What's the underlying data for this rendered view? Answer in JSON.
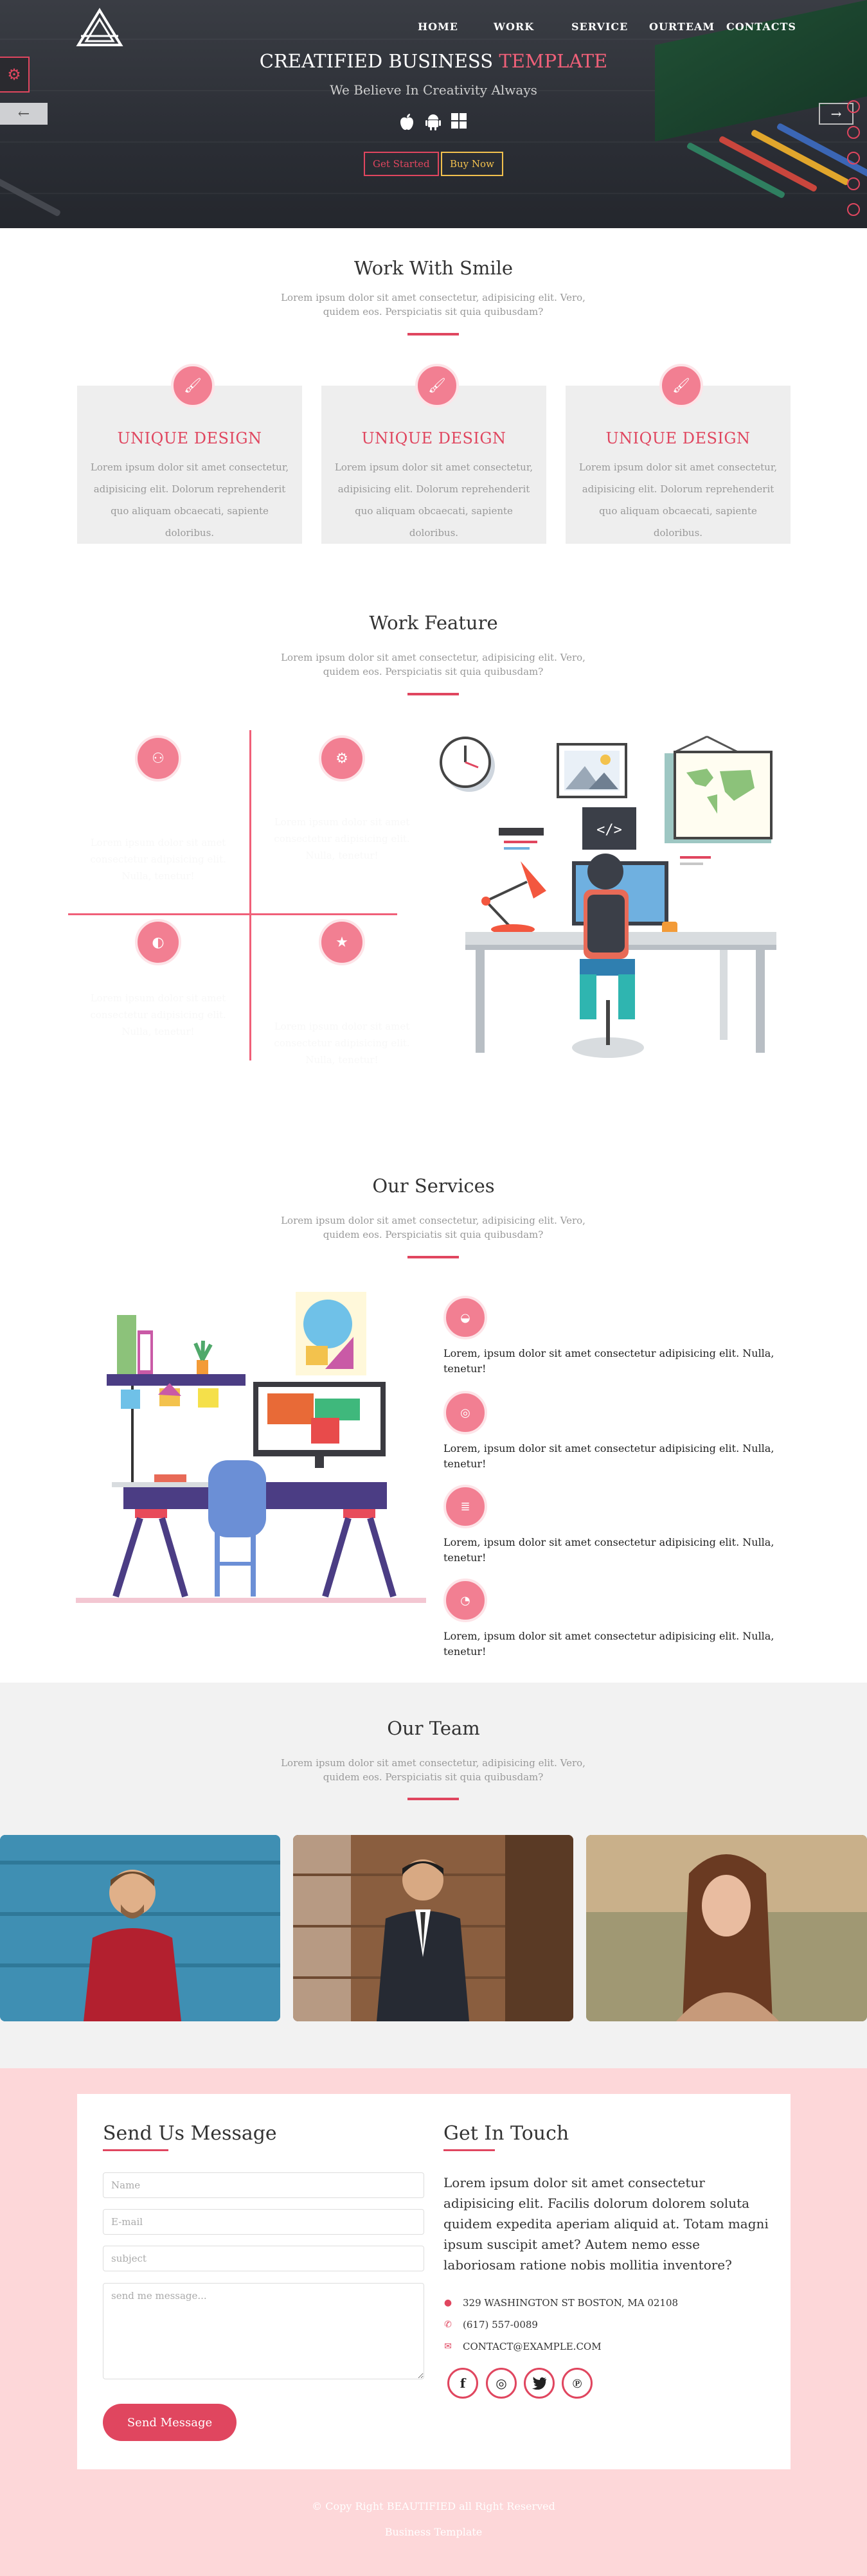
{
  "nav": {
    "items": [
      "HOME",
      "WORK",
      "SERVICE",
      "OURTEAM",
      "CONTACTS"
    ]
  },
  "hero": {
    "title_main": "CREATIFIED BUSINESS",
    "title_accent": "TEMPLATE",
    "subtitle": "We Believe In Creativity Always",
    "platform_icons": [
      "apple-icon",
      "android-icon",
      "windows-icon"
    ],
    "btn_started": "Get Started",
    "btn_buy": "Buy Now"
  },
  "smile": {
    "title": "Work With Smile",
    "subtitle": "Lorem ipsum dolor sit amet consectetur, adipisicing elit. Vero, quidem eos. Perspiciatis sit quia quibusdam?",
    "cards": [
      {
        "title": "UNIQUE DESIGN",
        "text": "Lorem ipsum dolor sit amet consectetur, adipisicing elit. Dolorum reprehenderit quo aliquam obcaecati, sapiente doloribus."
      },
      {
        "title": "UNIQUE DESIGN",
        "text": "Lorem ipsum dolor sit amet consectetur, adipisicing elit. Dolorum reprehenderit quo aliquam obcaecati, sapiente doloribus."
      },
      {
        "title": "UNIQUE DESIGN",
        "text": "Lorem ipsum dolor sit amet consectetur, adipisicing elit. Dolorum reprehenderit quo aliquam obcaecati, sapiente doloribus."
      }
    ]
  },
  "feature": {
    "title": "Work Feature",
    "subtitle": "Lorem ipsum dolor sit amet consectetur, adipisicing elit. Vero, quidem eos. Perspiciatis sit quia quibusdam?",
    "items": [
      {
        "text": "Lorem ipsum dolor sit amet consectetur adipisicing elit. Nulla, tenetur!"
      },
      {
        "text": "Lorem ipsum dolor sit amet consectetur adipisicing elit. Nulla, tenetur!"
      },
      {
        "text": "Lorem ipsum dolor sit amet consectetur adipisicing elit. Nulla, tenetur!"
      },
      {
        "text": "Lorem ipsum dolor sit amet consectetur adipisicing elit. Nulla, tenetur!"
      }
    ]
  },
  "services": {
    "title": "Our Services",
    "subtitle": "Lorem ipsum dolor sit amet consectetur, adipisicing elit. Vero, quidem eos. Perspiciatis sit quia quibusdam?",
    "items": [
      "Lorem, ipsum dolor sit amet consectetur adipisicing elit. Nulla, tenetur!",
      "Lorem, ipsum dolor sit amet consectetur adipisicing elit. Nulla, tenetur!",
      "Lorem, ipsum dolor sit amet consectetur adipisicing elit. Nulla, tenetur!",
      "Lorem, ipsum dolor sit amet consectetur adipisicing elit. Nulla, tenetur!"
    ]
  },
  "team": {
    "title": "Our Team",
    "subtitle": "Lorem ipsum dolor sit amet consectetur, adipisicing elit. Vero, quidem eos. Perspiciatis sit quia quibusdam?"
  },
  "contact": {
    "form_title": "Send Us Message",
    "name_placeholder": "Name",
    "email_placeholder": "E-mail",
    "subject_placeholder": "subject",
    "message_placeholder": "send me message...",
    "send_label": "Send Message",
    "touch_title": "Get In Touch",
    "touch_text": "Lorem ipsum dolor sit amet consectetur adipisicing elit. Facilis dolorum dolorem soluta quidem expedita aperiam aliquid at. Totam magni ipsum suscipit amet? Autem nemo esse laboriosam ratione nobis mollitia inventore?",
    "address": "329 WASHINGTON ST BOSTON, MA 02108",
    "phone": "(617) 557-0089",
    "email": "CONTACT@EXAMPLE.COM",
    "social_icons": [
      "facebook-icon",
      "instagram-icon",
      "twitter-icon",
      "pinterest-icon"
    ]
  },
  "footer": {
    "copyright": "© Copy Right BEAUTIFIED all Right Reserved",
    "tagline": "Business Template"
  },
  "colors": {
    "accent": "#e0465f",
    "accent_light": "#f27f92",
    "contact_bg": "#fdd7d9",
    "hero_dark": "#2b2e35"
  }
}
